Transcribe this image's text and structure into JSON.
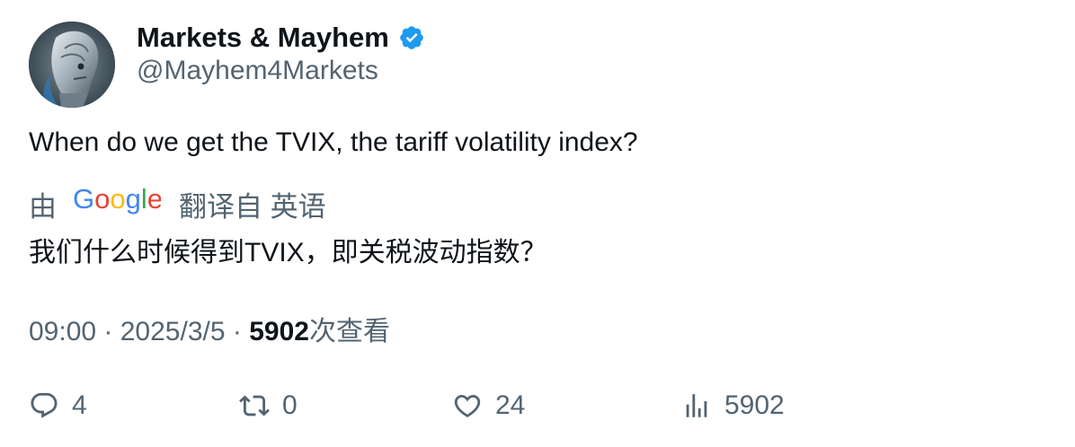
{
  "author": {
    "display_name": "Markets & Mayhem",
    "handle": "@Mayhem4Markets",
    "avatar_icon": "robot-avatar-icon",
    "verified_icon": "verified-badge-icon",
    "verified_color": "#1d9bf0"
  },
  "tweet": {
    "text": "When do we get the TVIX, the tariff volatility index?"
  },
  "translation": {
    "by_label": "由",
    "provider": "Google",
    "from_label": "翻译自 英语",
    "translated_text": "我们什么时候得到TVIX，即关税波动指数？"
  },
  "meta": {
    "time": "09:00",
    "separator": " · ",
    "date": "2025/3/5",
    "views_count": "5902",
    "views_label": "次查看"
  },
  "actions": {
    "reply_count": "4",
    "retweet_count": "0",
    "like_count": "24",
    "views_count": "5902"
  },
  "colors": {
    "text_primary": "#0f1419",
    "text_secondary": "#536471",
    "google_blue": "#4285f4",
    "google_red": "#ea4335",
    "google_yellow": "#fbbc05",
    "google_green": "#34a853"
  }
}
